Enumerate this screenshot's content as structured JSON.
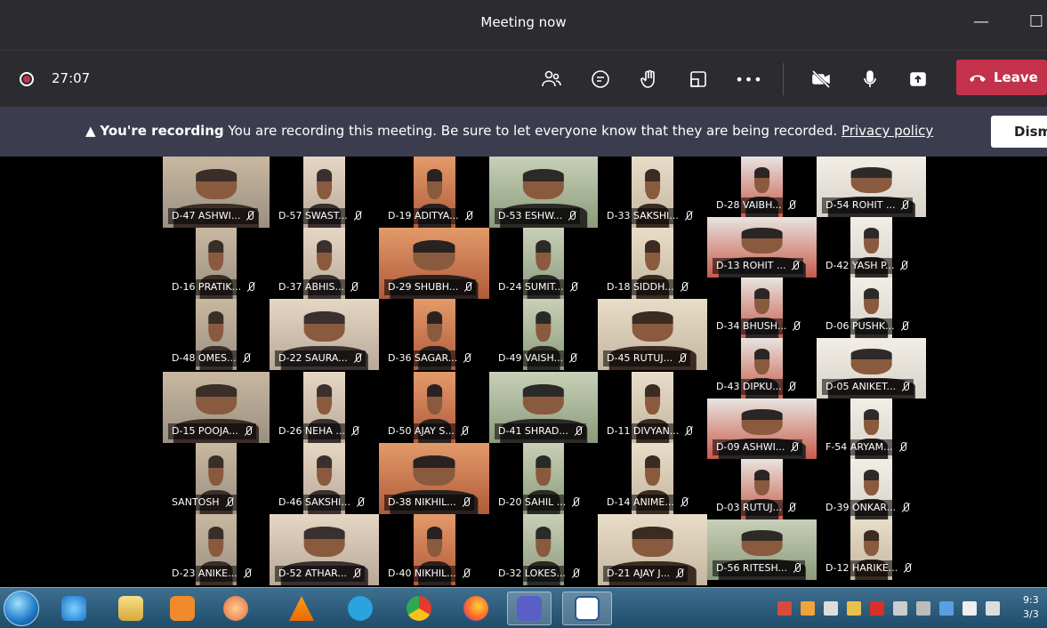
{
  "window": {
    "title": "Meeting now",
    "minimize_glyph": "—",
    "maximize_glyph": "☐"
  },
  "toolbar": {
    "recording_time": "27:07",
    "icons": [
      "participants-icon",
      "chat-icon",
      "raise-hand-icon",
      "share-tray-icon",
      "more-icon",
      "camera-off-icon",
      "mic-icon",
      "share-screen-icon"
    ],
    "more_label": "•••",
    "leave_label": "Leave",
    "leave_color": "#c4314b"
  },
  "banner": {
    "warning_glyph": "▲",
    "bold": "You're recording",
    "message": "You are recording this meeting. Be sure to let everyone know that they are being recorded.",
    "link": "Privacy policy",
    "dismiss_label": "Dism"
  },
  "participants": [
    {
      "name": "D-47 ASHWI..."
    },
    {
      "name": "D-57 SWAST..."
    },
    {
      "name": "D-19 ADITYA..."
    },
    {
      "name": "D-53 ESHW..."
    },
    {
      "name": "D-33 SAKSHI..."
    },
    {
      "name": "D-28 VAIBH..."
    },
    {
      "name": "D-54 ROHIT ..."
    },
    {
      "name": "D-16 PRATIK..."
    },
    {
      "name": "D-37 ABHIS..."
    },
    {
      "name": "D-29 SHUBH..."
    },
    {
      "name": "D-24 SUMIT..."
    },
    {
      "name": "D-18 SIDDH..."
    },
    {
      "name": "D-13 ROHIT ..."
    },
    {
      "name": "D-42 YASH P..."
    },
    {
      "name": "D-48 OMES..."
    },
    {
      "name": "D-22 SAURA..."
    },
    {
      "name": "D-36 SAGAR..."
    },
    {
      "name": "D-49 VAISH..."
    },
    {
      "name": "D-45 RUTUJ..."
    },
    {
      "name": "D-34 BHUSH..."
    },
    {
      "name": "D-06 PUSHK..."
    },
    {
      "name": "D-15 POOJA..."
    },
    {
      "name": "D-26 NEHA ..."
    },
    {
      "name": "D-50 AJAY S..."
    },
    {
      "name": "D-41 SHRAD..."
    },
    {
      "name": "D-11 DIVYAN..."
    },
    {
      "name": "D-43 DIPKU..."
    },
    {
      "name": "D-05 ANIKET..."
    },
    {
      "name": "SANTOSH"
    },
    {
      "name": "D-46 SAKSHI..."
    },
    {
      "name": "D-38 NIKHIL..."
    },
    {
      "name": "D-20 SAHIL ..."
    },
    {
      "name": "D-14 ANIME..."
    },
    {
      "name": "D-09 ASHWI..."
    },
    {
      "name": "F-54 ARYAM..."
    },
    {
      "name": "D-23 ANIKE..."
    },
    {
      "name": "D-52 ATHAR..."
    },
    {
      "name": "D-40 NIKHIL..."
    },
    {
      "name": "D-32 LOKES..."
    },
    {
      "name": "D-21 AJAY J..."
    },
    {
      "name": "D-03 RUTUJ..."
    },
    {
      "name": "D-39 ONKAR..."
    },
    {
      "name": "D-56 RITESH..."
    },
    {
      "name": "D-12 HARIKE..."
    }
  ],
  "taskbar": {
    "apps": [
      "internet-explorer",
      "file-explorer",
      "media-player",
      "paint",
      "vlc",
      "telegram",
      "chrome",
      "firefox",
      "teams",
      "word"
    ],
    "clock_time": "9:3",
    "clock_date": "3/3"
  }
}
